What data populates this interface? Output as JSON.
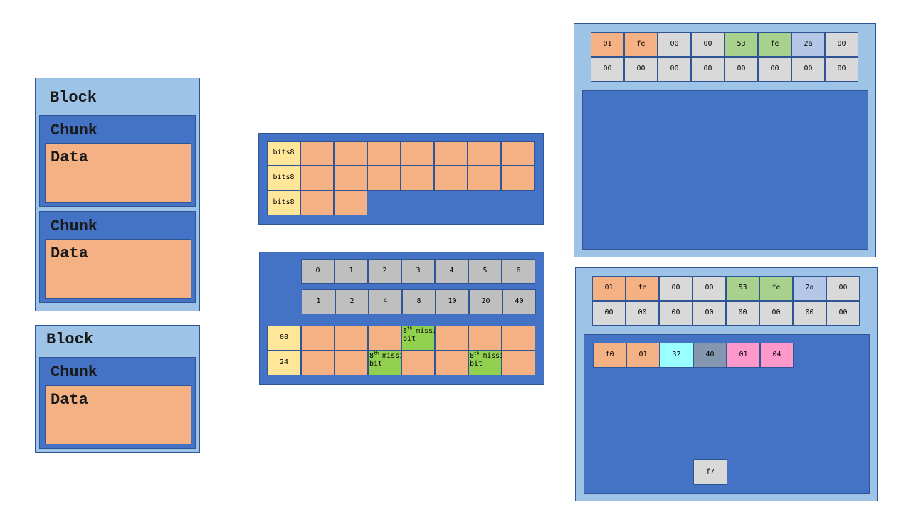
{
  "colors": {
    "light_blue": "#9dc3e6",
    "dark_blue": "#4472c4",
    "border": "#2f5597",
    "peach": "#f4b183",
    "yellow": "#ffe699",
    "gray": "#bfbfbf",
    "light_gray": "#d9d9d9",
    "green": "#a9d18e",
    "bright_green": "#92d050",
    "periwinkle": "#b4c7e7",
    "cyan": "#99ffff",
    "slate": "#8497b0",
    "pink": "#ff99cc"
  },
  "structure": {
    "block1": {
      "title": "Block",
      "chunks": [
        {
          "title": "Chunk",
          "data": "Data"
        },
        {
          "title": "Chunk",
          "data": "Data"
        }
      ]
    },
    "block2": {
      "title": "Block",
      "chunks": [
        {
          "title": "Chunk",
          "data": "Data"
        }
      ]
    }
  },
  "bits_table": {
    "rows": [
      {
        "label": "bits8",
        "cells": 7
      },
      {
        "label": "bits8",
        "cells": 7
      },
      {
        "label": "bits8",
        "cells": 2
      }
    ]
  },
  "bit_table": {
    "index_row": [
      "0",
      "1",
      "2",
      "3",
      "4",
      "5",
      "6"
    ],
    "value_row": [
      "1",
      "2",
      "4",
      "8",
      "10",
      "20",
      "40"
    ],
    "data_rows": [
      {
        "label": "08",
        "missing_cols": [
          3
        ]
      },
      {
        "label": "24",
        "missing_cols": [
          2,
          5
        ]
      }
    ],
    "missing_prefix": "8",
    "missing_sup": "th",
    "missing_bit": " bit",
    "missing_word": "missing"
  },
  "hex_top": {
    "row1": [
      {
        "v": "01",
        "c": "peach"
      },
      {
        "v": "fe",
        "c": "peach"
      },
      {
        "v": "00",
        "c": "light_gray"
      },
      {
        "v": "00",
        "c": "light_gray"
      },
      {
        "v": "53",
        "c": "green"
      },
      {
        "v": "fe",
        "c": "green"
      },
      {
        "v": "2a",
        "c": "periwinkle"
      },
      {
        "v": "00",
        "c": "light_gray"
      }
    ],
    "row2": [
      "00",
      "00",
      "00",
      "00",
      "00",
      "00",
      "00",
      "00"
    ]
  },
  "hex_bottom": {
    "row1": [
      {
        "v": "01",
        "c": "peach"
      },
      {
        "v": "fe",
        "c": "peach"
      },
      {
        "v": "00",
        "c": "light_gray"
      },
      {
        "v": "00",
        "c": "light_gray"
      },
      {
        "v": "53",
        "c": "green"
      },
      {
        "v": "fe",
        "c": "green"
      },
      {
        "v": "2a",
        "c": "periwinkle"
      },
      {
        "v": "00",
        "c": "light_gray"
      }
    ],
    "row2": [
      "00",
      "00",
      "00",
      "00",
      "00",
      "00",
      "00",
      "00"
    ],
    "inner_row": [
      {
        "v": "f0",
        "c": "peach"
      },
      {
        "v": "01",
        "c": "peach"
      },
      {
        "v": "32",
        "c": "cyan"
      },
      {
        "v": "40",
        "c": "slate"
      },
      {
        "v": "01",
        "c": "pink"
      },
      {
        "v": "04",
        "c": "pink"
      }
    ],
    "end": {
      "v": "f7",
      "c": "light_gray"
    }
  }
}
